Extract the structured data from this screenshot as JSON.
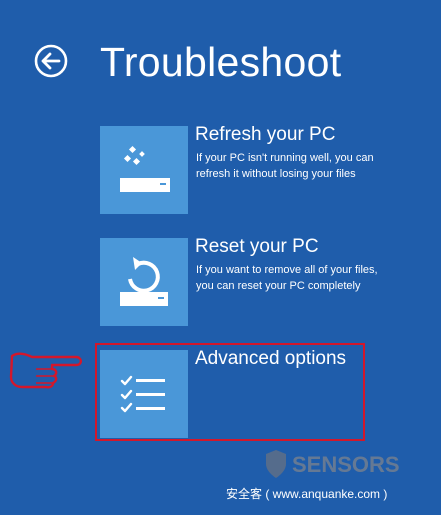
{
  "page": {
    "title": "Troubleshoot",
    "back_icon": "back-arrow-icon"
  },
  "options": [
    {
      "title": "Refresh your PC",
      "description_line1": "If your PC isn't running well, you can",
      "description_line2": "refresh it without losing your files",
      "icon": "refresh-pc-icon"
    },
    {
      "title": "Reset your PC",
      "description_line1": "If you want to remove all of your files,",
      "description_line2": "you can reset your PC completely",
      "icon": "reset-pc-icon"
    },
    {
      "title": "Advanced options",
      "icon": "checklist-icon",
      "highlighted": true
    }
  ],
  "watermark": {
    "logo_text": "SENSORS",
    "site_text": "安全客 ( www.anquanke.com )"
  },
  "colors": {
    "background": "#1f5dab",
    "tile": "#4a97d8",
    "highlight": "#d3172b"
  }
}
